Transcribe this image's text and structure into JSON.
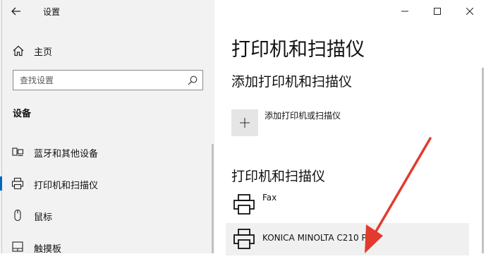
{
  "window": {
    "app_title": "设置",
    "controls": [
      "minimize",
      "maximize",
      "close"
    ]
  },
  "sidebar": {
    "home_label": "主页",
    "search": {
      "placeholder": "查找设置",
      "value": ""
    },
    "section_heading": "设备",
    "items": [
      {
        "label": "蓝牙和其他设备",
        "icon": "bluetooth-devices-icon",
        "selected": false
      },
      {
        "label": "打印机和扫描仪",
        "icon": "printer-icon",
        "selected": true
      },
      {
        "label": "鼠标",
        "icon": "mouse-icon",
        "selected": false
      },
      {
        "label": "触摸板",
        "icon": "touchpad-icon",
        "selected": false
      }
    ]
  },
  "main": {
    "page_title": "打印机和扫描仪",
    "add_section_heading": "添加打印机和扫描仪",
    "add_button_label": "添加打印机或扫描仪",
    "list_heading": "打印机和扫描仪",
    "printers": [
      {
        "name": "Fax",
        "icon": "printer-icon"
      },
      {
        "name": "KONICA MINOLTA C210 PCL",
        "icon": "printer-icon"
      }
    ]
  },
  "colors": {
    "accent": "#0067c0",
    "sidebar_bg": "#f2f2f2",
    "tile_bg": "#e5e5e5",
    "annotation_arrow": "#e23b2e"
  }
}
